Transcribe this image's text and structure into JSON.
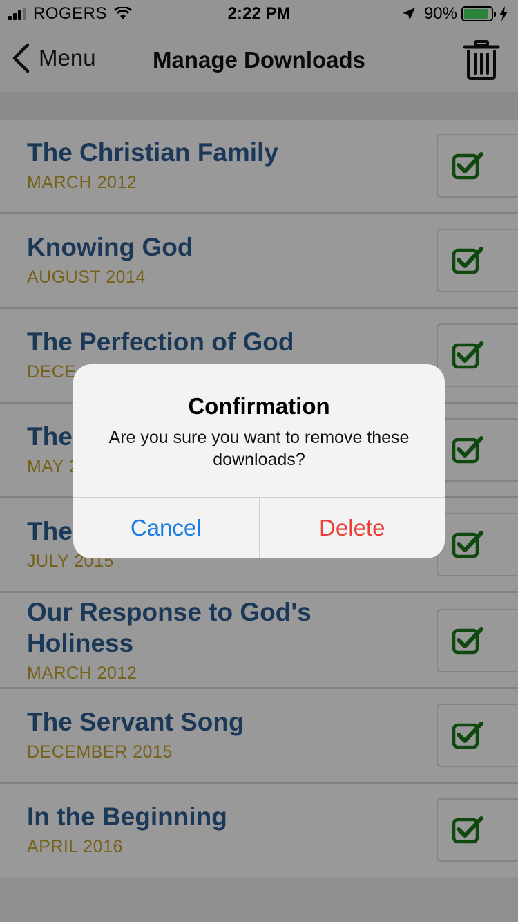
{
  "status_bar": {
    "carrier": "ROGERS",
    "time": "2:22 PM",
    "battery_percent": "90%",
    "battery_level": 0.9
  },
  "nav": {
    "back_label": "Menu",
    "title": "Manage Downloads"
  },
  "items": [
    {
      "title": "The Christian Family",
      "date": "MARCH 2012",
      "checked": true
    },
    {
      "title": "Knowing God",
      "date": "AUGUST 2014",
      "checked": true
    },
    {
      "title": "The Perfection of God",
      "date": "DECE",
      "checked": true
    },
    {
      "title": "The",
      "date": "MAY 2",
      "checked": true
    },
    {
      "title": "The",
      "date": "JULY 2015",
      "checked": true
    },
    {
      "title": "Our Response to God's Holiness",
      "date": "MARCH 2012",
      "checked": true
    },
    {
      "title": "The Servant Song",
      "date": "DECEMBER 2015",
      "checked": true
    },
    {
      "title": "In the Beginning",
      "date": "APRIL 2016",
      "checked": true
    }
  ],
  "dialog": {
    "title": "Confirmation",
    "message": "Are you sure you want to remove these downloads?",
    "cancel_label": "Cancel",
    "delete_label": "Delete"
  },
  "colors": {
    "title_blue": "#2f5e93",
    "date_gold": "#c5a22b",
    "check_green": "#1a7a1a",
    "cancel_blue": "#1a7ee0",
    "delete_red": "#e8403a"
  }
}
